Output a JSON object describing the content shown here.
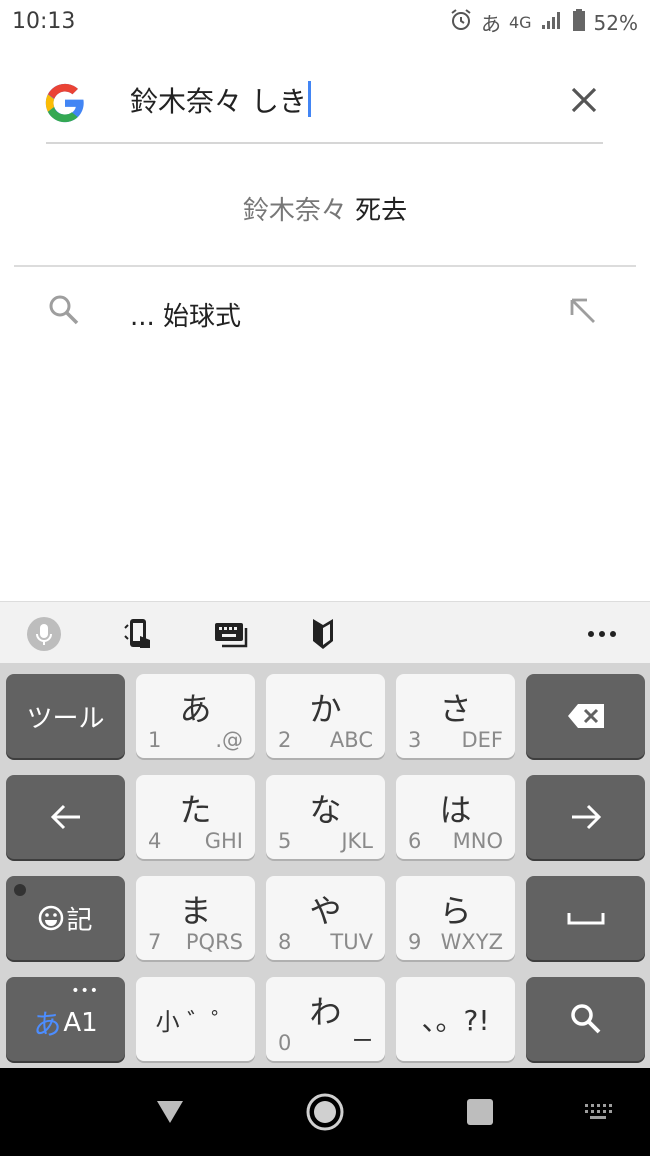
{
  "status": {
    "time": "10:13",
    "ime_indicator": "あ",
    "network": "4G",
    "battery": "52%"
  },
  "search": {
    "query": "鈴木奈々 しき"
  },
  "suggestion_chip": {
    "prefix": "鈴木奈々",
    "completion": "死去"
  },
  "suggestions": [
    {
      "text": "... 始球式"
    }
  ],
  "keyboard": {
    "rows": [
      [
        {
          "type": "dark",
          "label": "ツール"
        },
        {
          "type": "light",
          "main": "あ",
          "num": "1",
          "alpha": ".@"
        },
        {
          "type": "light",
          "main": "か",
          "num": "2",
          "alpha": "ABC"
        },
        {
          "type": "light",
          "main": "さ",
          "num": "3",
          "alpha": "DEF"
        },
        {
          "type": "dark",
          "icon": "backspace-icon"
        }
      ],
      [
        {
          "type": "dark",
          "icon": "arrow-left-icon"
        },
        {
          "type": "light",
          "main": "た",
          "num": "4",
          "alpha": "GHI"
        },
        {
          "type": "light",
          "main": "な",
          "num": "5",
          "alpha": "JKL"
        },
        {
          "type": "light",
          "main": "は",
          "num": "6",
          "alpha": "MNO"
        },
        {
          "type": "dark",
          "icon": "arrow-right-icon"
        }
      ],
      [
        {
          "type": "dark",
          "icon": "emoji-symbol-icon",
          "label": "記"
        },
        {
          "type": "light",
          "main": "ま",
          "num": "7",
          "alpha": "PQRS"
        },
        {
          "type": "light",
          "main": "や",
          "num": "8",
          "alpha": "TUV"
        },
        {
          "type": "light",
          "main": "ら",
          "num": "9",
          "alpha": "WXYZ"
        },
        {
          "type": "dark",
          "icon": "space-icon"
        }
      ],
      [
        {
          "type": "dark",
          "icon": "input-mode-icon",
          "label_kana": "あ",
          "label_alpha": "A1"
        },
        {
          "type": "light",
          "label": "小 ゛゜"
        },
        {
          "type": "light",
          "main": "わ",
          "num": "0",
          "alpha": "ー"
        },
        {
          "type": "light",
          "label": "、。?!"
        },
        {
          "type": "dark",
          "icon": "search-icon"
        }
      ]
    ]
  },
  "colors": {
    "caret": "#4285f4",
    "key_dark": "#626262",
    "key_light": "#f6f6f6"
  }
}
